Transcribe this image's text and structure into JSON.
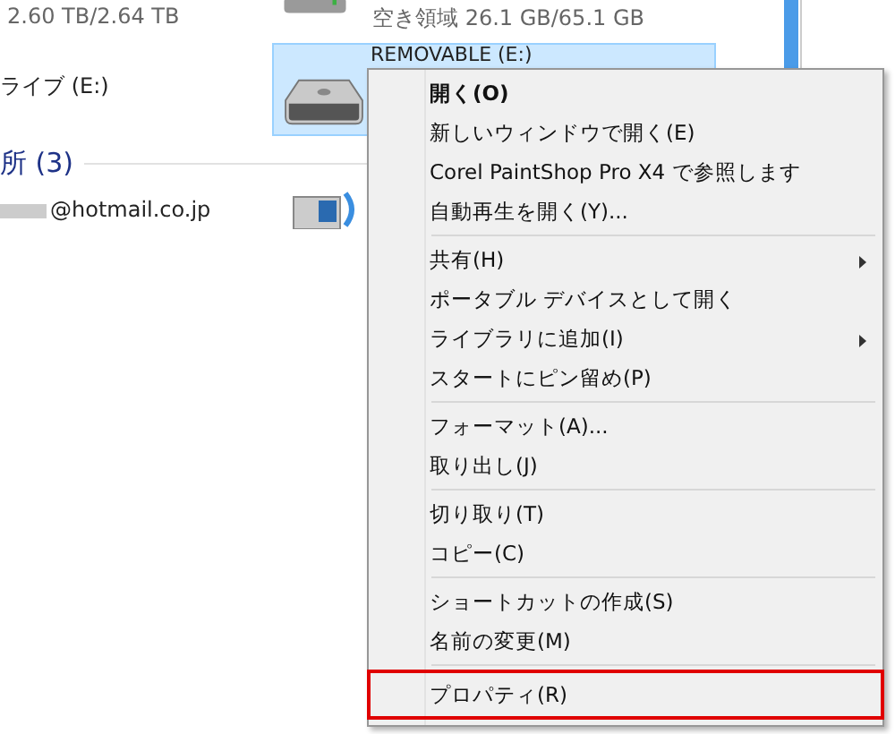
{
  "explorer": {
    "capacity_text": "2.60 TB/2.64 TB",
    "free_space_text": "空き領域 26.1 GB/65.1 GB",
    "drive_label": "ライブ (E:)",
    "selected_tile": {
      "title": "REMOVABLE (E:)",
      "selected": true
    },
    "section_heading": "所 (3)",
    "account_text": "@hotmail.co.jp"
  },
  "menu": {
    "groups": [
      [
        {
          "label": "開く(O)",
          "default": true,
          "submenu": false,
          "highlighted": false
        },
        {
          "label": "新しいウィンドウで開く(E)",
          "default": false,
          "submenu": false,
          "highlighted": false
        },
        {
          "label": "Corel PaintShop Pro X4 で参照します",
          "default": false,
          "submenu": false,
          "highlighted": false
        },
        {
          "label": "自動再生を開く(Y)...",
          "default": false,
          "submenu": false,
          "highlighted": false
        }
      ],
      [
        {
          "label": "共有(H)",
          "default": false,
          "submenu": true,
          "highlighted": false
        },
        {
          "label": "ポータブル デバイスとして開く",
          "default": false,
          "submenu": false,
          "highlighted": false
        },
        {
          "label": "ライブラリに追加(I)",
          "default": false,
          "submenu": true,
          "highlighted": false
        },
        {
          "label": "スタートにピン留め(P)",
          "default": false,
          "submenu": false,
          "highlighted": false
        }
      ],
      [
        {
          "label": "フォーマット(A)...",
          "default": false,
          "submenu": false,
          "highlighted": false
        },
        {
          "label": "取り出し(J)",
          "default": false,
          "submenu": false,
          "highlighted": false
        }
      ],
      [
        {
          "label": "切り取り(T)",
          "default": false,
          "submenu": false,
          "highlighted": false
        },
        {
          "label": "コピー(C)",
          "default": false,
          "submenu": false,
          "highlighted": false
        }
      ],
      [
        {
          "label": "ショートカットの作成(S)",
          "default": false,
          "submenu": false,
          "highlighted": false
        },
        {
          "label": "名前の変更(M)",
          "default": false,
          "submenu": false,
          "highlighted": false
        }
      ],
      [
        {
          "label": "プロパティ(R)",
          "default": false,
          "submenu": false,
          "highlighted": true
        }
      ]
    ]
  }
}
